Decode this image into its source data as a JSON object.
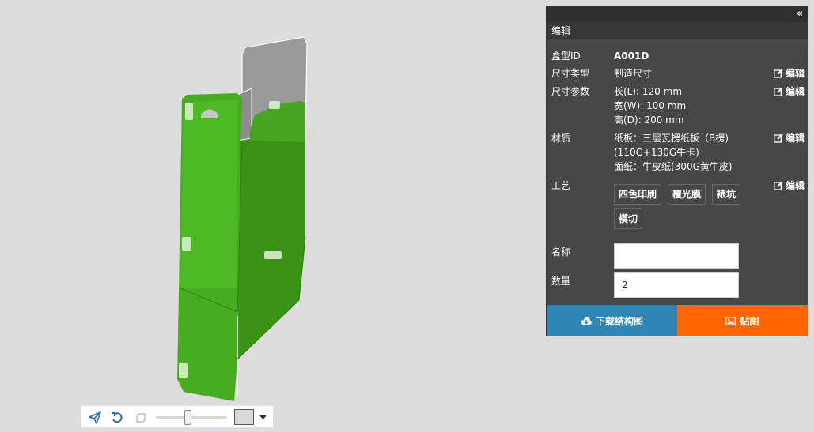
{
  "panel": {
    "collapse_glyph": "«",
    "title": "编辑",
    "fields": {
      "box_id": {
        "label": "盒型ID",
        "value": "A001D"
      },
      "size_type": {
        "label": "尺寸类型",
        "value": "制造尺寸",
        "edit": "编辑"
      },
      "size_params": {
        "label": "尺寸参数",
        "length": "长(L): 120 mm",
        "width": "宽(W): 100 mm",
        "height": "高(D): 200 mm",
        "edit": "编辑"
      },
      "material": {
        "label": "材质",
        "line1": "纸板：三层瓦楞纸板（B楞)",
        "line2": "(110G+130G牛卡)",
        "line3": "面纸：牛皮纸(300G黄牛皮)",
        "edit": "编辑"
      },
      "process": {
        "label": "工艺",
        "tags": [
          "四色印刷",
          "覆光膜",
          "裱坑",
          "模切"
        ],
        "edit": "编辑"
      },
      "name": {
        "label": "名称",
        "value": ""
      },
      "quantity": {
        "label": "数量",
        "value": "2"
      }
    },
    "buttons": {
      "download": "下载结构图",
      "texture": "贴图"
    },
    "icons": {
      "edit": "edit-icon",
      "download": "cloud-download-icon",
      "texture": "image-icon"
    }
  },
  "toolbar": {
    "icons": [
      "send-icon",
      "rotate-left-icon",
      "shape-icon",
      "zoom-slider",
      "color-swatch",
      "dropdown-caret-icon"
    ],
    "zoom_level": 0.45,
    "background_color": "#d9d9d9"
  },
  "colors": {
    "box_green": "#4ab221",
    "panel_bg": "#474747",
    "download_blue": "#2e86b7",
    "texture_orange": "#ff6600"
  }
}
